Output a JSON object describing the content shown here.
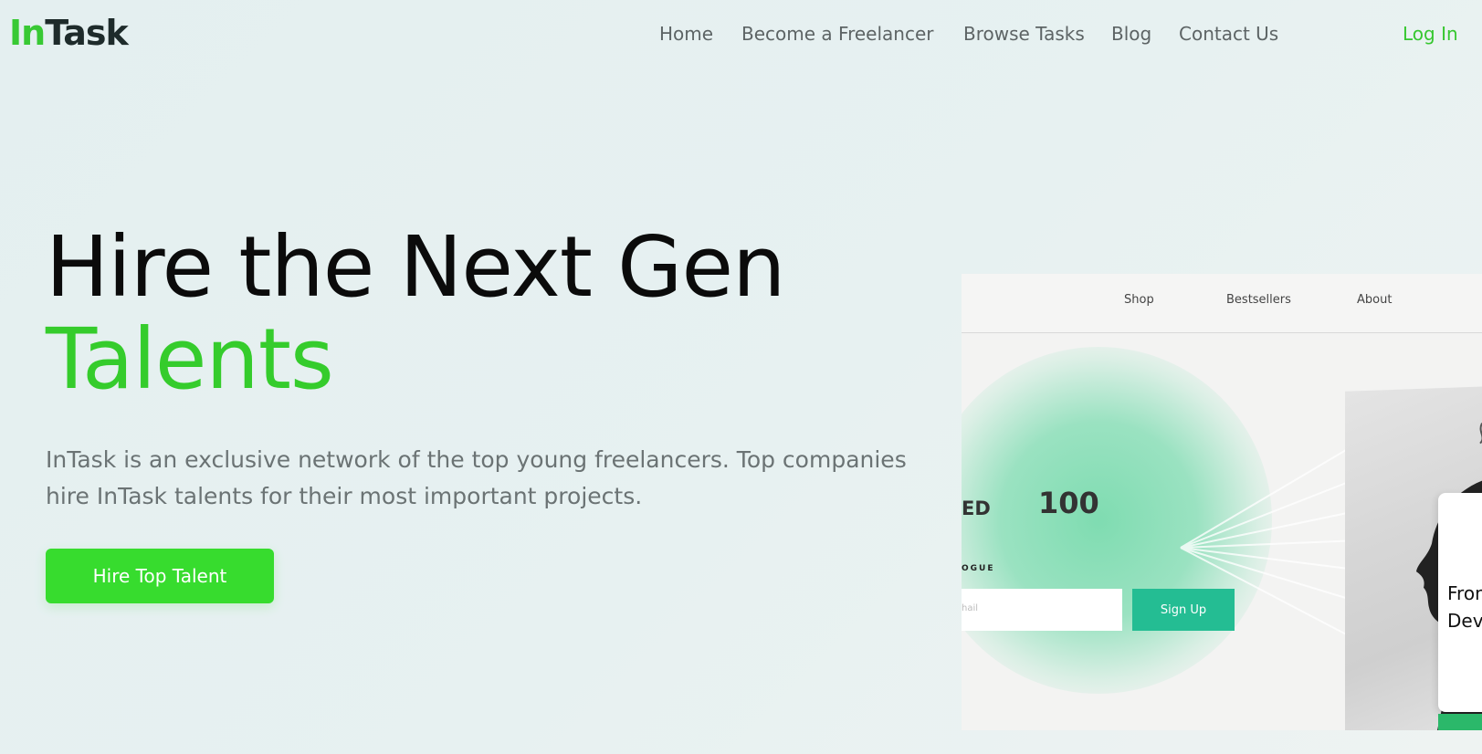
{
  "header": {
    "logo_part1": "In",
    "logo_part2": "Task",
    "nav": [
      "Home",
      "Become a Freelancer",
      "Browse Tasks",
      "Blog",
      "Contact Us"
    ],
    "login": "Log In"
  },
  "hero": {
    "title_line1": "Hire the Next Gen",
    "title_line2": "Talents",
    "subtitle": "InTask is an exclusive network of the top young freelancers. Top companies hire InTask talents for their most important projects.",
    "cta": "Hire Top Talent"
  },
  "mockup": {
    "nav": [
      "Shop",
      "Bestsellers",
      "About"
    ],
    "text_ed": "ED",
    "text_100": "100",
    "text_ogue": "OGUE",
    "input_placeholder": "hail",
    "signup": "Sign Up",
    "card_line1": "Fron",
    "card_line2": "Dev"
  },
  "colors": {
    "brand_green": "#38c934",
    "cta_green": "#37dc2e",
    "mock_teal": "#24bd93"
  }
}
